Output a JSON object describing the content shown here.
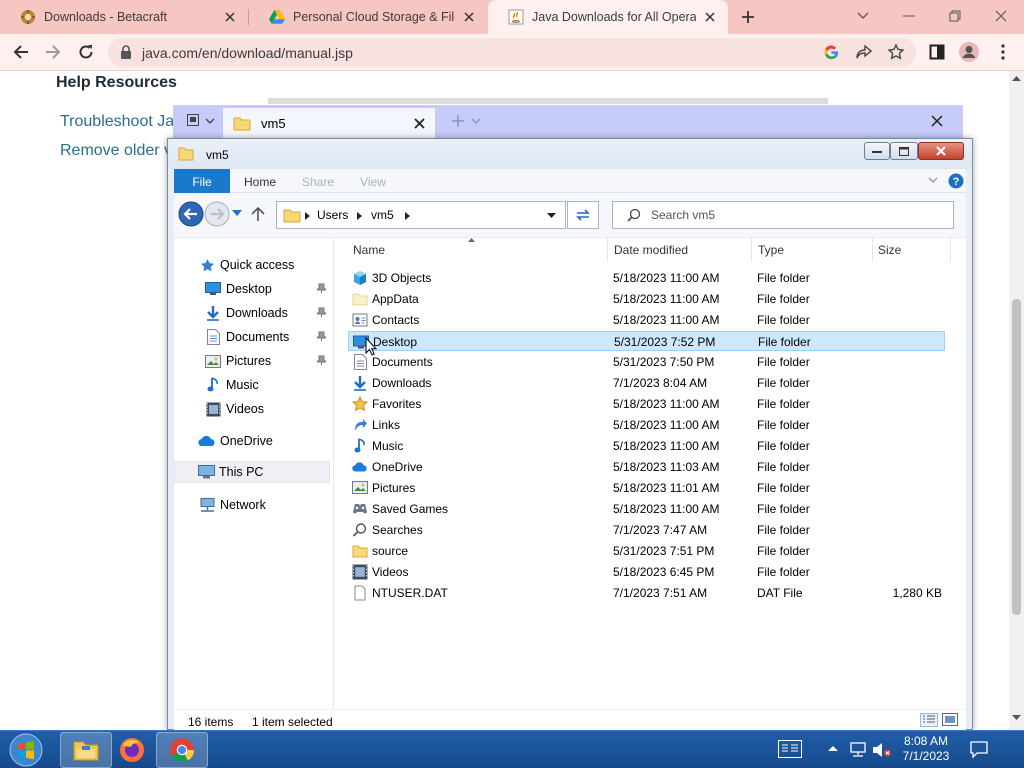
{
  "browser": {
    "tabs": [
      {
        "title": "Downloads - Betacraft",
        "icon": "betacraft-icon"
      },
      {
        "title": "Personal Cloud Storage & File Sh",
        "icon": "google-drive-icon"
      },
      {
        "title": "Java Downloads for All Operating",
        "icon": "java-icon",
        "active": true
      }
    ],
    "url": "java.com/en/download/manual.jsp"
  },
  "webpage": {
    "heading": "Help Resources",
    "links": [
      "Troubleshoot Jav",
      "Remove older ve"
    ]
  },
  "explorer": {
    "outer_tab_title": "vm5",
    "window_title": "vm5",
    "ribbon_tabs": [
      "File",
      "Home",
      "Share",
      "View"
    ],
    "breadcrumb": [
      "Users",
      "vm5"
    ],
    "search_placeholder": "Search vm5",
    "nav": {
      "quick_access": "Quick access",
      "quick_items": [
        "Desktop",
        "Downloads",
        "Documents",
        "Pictures",
        "Music",
        "Videos"
      ],
      "onedrive": "OneDrive",
      "this_pc": "This PC",
      "network": "Network"
    },
    "columns": {
      "name": "Name",
      "date": "Date modified",
      "type": "Type",
      "size": "Size"
    },
    "files": [
      {
        "name": "3D Objects",
        "date": "5/18/2023 11:00 AM",
        "type": "File folder",
        "size": "",
        "icon": "3d-objects-icon"
      },
      {
        "name": "AppData",
        "date": "5/18/2023 11:00 AM",
        "type": "File folder",
        "size": "",
        "icon": "hidden-folder-icon"
      },
      {
        "name": "Contacts",
        "date": "5/18/2023 11:00 AM",
        "type": "File folder",
        "size": "",
        "icon": "contacts-icon"
      },
      {
        "name": "Desktop",
        "date": "5/31/2023 7:52 PM",
        "type": "File folder",
        "size": "",
        "icon": "desktop-icon",
        "selected": true
      },
      {
        "name": "Documents",
        "date": "5/31/2023 7:50 PM",
        "type": "File folder",
        "size": "",
        "icon": "documents-icon"
      },
      {
        "name": "Downloads",
        "date": "7/1/2023 8:04 AM",
        "type": "File folder",
        "size": "",
        "icon": "downloads-icon"
      },
      {
        "name": "Favorites",
        "date": "5/18/2023 11:00 AM",
        "type": "File folder",
        "size": "",
        "icon": "favorites-star-icon"
      },
      {
        "name": "Links",
        "date": "5/18/2023 11:00 AM",
        "type": "File folder",
        "size": "",
        "icon": "links-icon"
      },
      {
        "name": "Music",
        "date": "5/18/2023 11:00 AM",
        "type": "File folder",
        "size": "",
        "icon": "music-icon"
      },
      {
        "name": "OneDrive",
        "date": "5/18/2023 11:03 AM",
        "type": "File folder",
        "size": "",
        "icon": "onedrive-icon"
      },
      {
        "name": "Pictures",
        "date": "5/18/2023 11:01 AM",
        "type": "File folder",
        "size": "",
        "icon": "pictures-icon"
      },
      {
        "name": "Saved Games",
        "date": "5/18/2023 11:00 AM",
        "type": "File folder",
        "size": "",
        "icon": "saved-games-icon"
      },
      {
        "name": "Searches",
        "date": "7/1/2023 7:47 AM",
        "type": "File folder",
        "size": "",
        "icon": "searches-icon"
      },
      {
        "name": "source",
        "date": "5/31/2023 7:51 PM",
        "type": "File folder",
        "size": "",
        "icon": "folder-icon"
      },
      {
        "name": "Videos",
        "date": "5/18/2023 6:45 PM",
        "type": "File folder",
        "size": "",
        "icon": "videos-icon"
      },
      {
        "name": "NTUSER.DAT",
        "date": "7/1/2023 7:51 AM",
        "type": "DAT File",
        "size": "1,280 KB",
        "icon": "file-icon"
      }
    ],
    "status": {
      "count": "16 items",
      "selection": "1 item selected"
    }
  },
  "taskbar": {
    "time": "8:08 AM",
    "date": "7/1/2023"
  },
  "colors": {
    "chrome_tabstrip": "#f6c6c2",
    "chrome_toolbar": "#fdf0ef",
    "explorer_tabbar": "#c6cbf7",
    "file_tab_blue": "#1979ca",
    "selection": "#cce8ff",
    "taskbar": "#1f5fa8"
  }
}
